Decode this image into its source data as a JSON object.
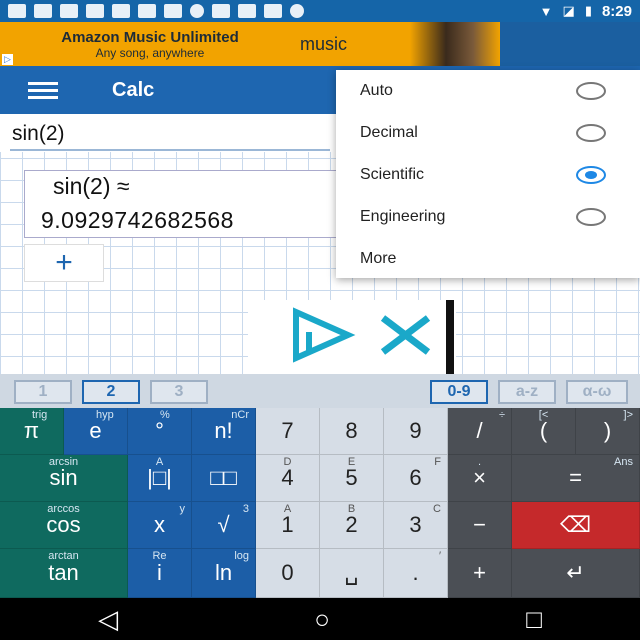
{
  "status": {
    "time": "8:29"
  },
  "ad": {
    "line1": "Amazon Music Unlimited",
    "line2": "Any song, anywhere",
    "logo": "music"
  },
  "appbar": {
    "title": "Calc"
  },
  "input": {
    "expression": "sin(2)"
  },
  "result": {
    "expression": "sin(2) ≈",
    "value": "9.0929742682568"
  },
  "add": {
    "label": "+"
  },
  "menu": {
    "items": [
      {
        "label": "Auto",
        "selected": false
      },
      {
        "label": "Decimal",
        "selected": false
      },
      {
        "label": "Scientific",
        "selected": true
      },
      {
        "label": "Engineering",
        "selected": false
      },
      {
        "label": "More"
      }
    ]
  },
  "tabs": [
    "1",
    "2",
    "3",
    "0-9",
    "a-z",
    "α-ω"
  ],
  "keys": {
    "r1": {
      "pi": "π",
      "pi_sup": "trig",
      "e": "e",
      "e_sup": "hyp",
      "deg": "°",
      "deg_sup": "%",
      "fact": "n!",
      "fact_sup": "nCr",
      "d7": "7",
      "d8": "8",
      "d9": "9",
      "div": "/",
      "div_sup": "÷",
      "lpar": "(",
      "lpar_sup": "[<",
      "rpar": ")",
      "rpar_sup": "]>"
    },
    "r2": {
      "sin": "sin",
      "sin_sup": "arcsin",
      "abs": "|□|",
      "abs_sup": "A",
      "pow": "□□",
      "d4": "4",
      "d4_sup": "D",
      "d5": "5",
      "d5_sup": "E",
      "d6": "6",
      "d6_sup": "F",
      "mul": "×",
      "mul_sup": ".",
      "eq": "=",
      "eq_sup": "Ans"
    },
    "r3": {
      "cos": "cos",
      "cos_sup": "arccos",
      "x": "x",
      "x_sup": "y",
      "sqrt": "√",
      "sqrt_sup": "3",
      "d1": "1",
      "d1_sup": "A",
      "d2": "2",
      "d2_sup": "B",
      "d3": "3",
      "d3_sup": "C",
      "minus": "−",
      "del": "⌫"
    },
    "r4": {
      "tan": "tan",
      "tan_sup": "arctan",
      "i": "i",
      "i_sup": "Re",
      "ln": "ln",
      "ln_sup": "log",
      "d0": "0",
      "space": "␣",
      "dot": ".",
      "dot_sup": "′",
      "plus": "+",
      "enter": "↵"
    }
  },
  "nav": {
    "back": "◁",
    "home": "○",
    "recent": "□"
  }
}
